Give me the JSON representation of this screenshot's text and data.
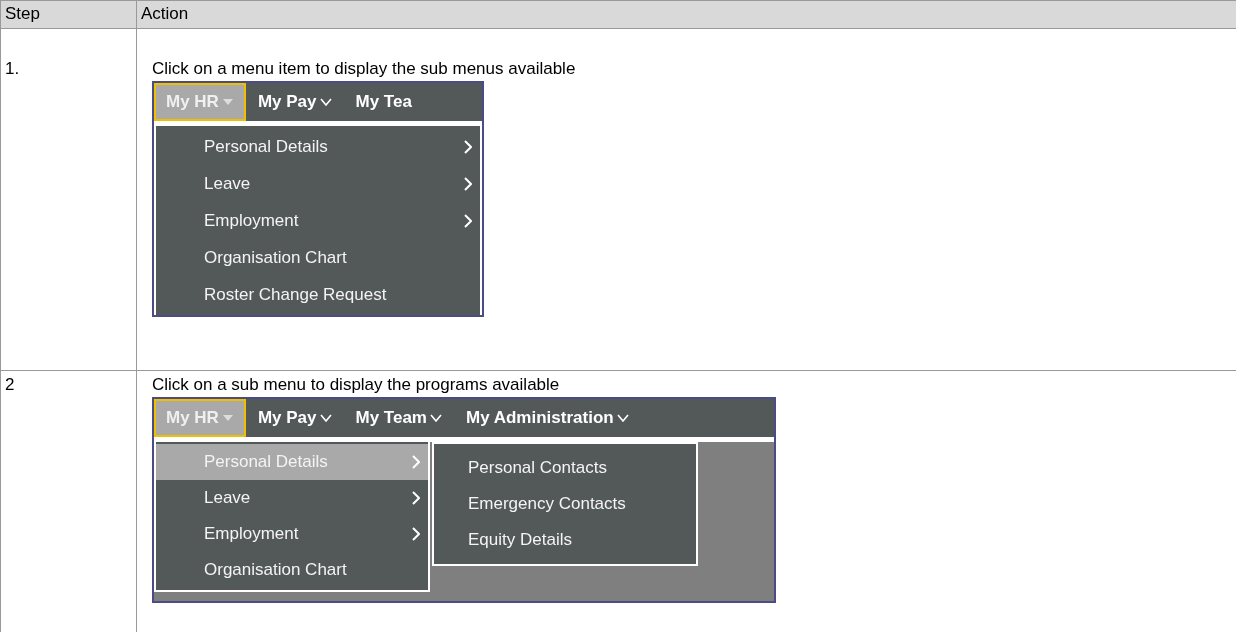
{
  "table": {
    "columns": [
      "Step",
      "Action"
    ],
    "rows": [
      {
        "step": "1.",
        "instruction": "Click on a menu item to display the sub menus available",
        "screenshot": {
          "menu_bar": [
            {
              "label": "My HR",
              "selected": true,
              "caret": true
            },
            {
              "label": "My Pay",
              "selected": false,
              "caret": true
            },
            {
              "label": "My Tea",
              "selected": false,
              "caret": false
            }
          ],
          "menu": [
            {
              "label": "Personal Details",
              "selected": false,
              "has_submenu": true
            },
            {
              "label": "Leave",
              "selected": false,
              "has_submenu": true
            },
            {
              "label": "Employment",
              "selected": false,
              "has_submenu": true
            },
            {
              "label": "Organisation Chart",
              "selected": false,
              "has_submenu": false
            },
            {
              "label": "Roster Change Request",
              "selected": false,
              "has_submenu": false
            }
          ]
        }
      },
      {
        "step": "2",
        "instruction": "Click on a sub menu to display the programs available",
        "screenshot": {
          "menu_bar": [
            {
              "label": "My HR",
              "selected": true,
              "caret": true
            },
            {
              "label": "My Pay",
              "selected": false,
              "caret": true
            },
            {
              "label": "My Team",
              "selected": false,
              "caret": true
            },
            {
              "label": "My Administration",
              "selected": false,
              "caret": true
            }
          ],
          "menu": [
            {
              "label": "Personal Details",
              "selected": true,
              "has_submenu": true
            },
            {
              "label": "Leave",
              "selected": false,
              "has_submenu": true
            },
            {
              "label": "Employment",
              "selected": false,
              "has_submenu": true
            },
            {
              "label": "Organisation Chart",
              "selected": false,
              "has_submenu": false
            }
          ],
          "submenu": [
            {
              "label": "Personal Contacts"
            },
            {
              "label": "Emergency Contacts"
            },
            {
              "label": "Equity Details"
            }
          ]
        }
      }
    ]
  }
}
